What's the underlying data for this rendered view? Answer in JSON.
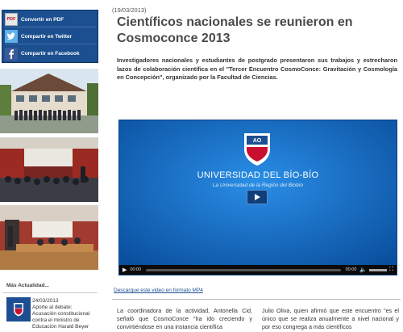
{
  "share": {
    "pdf_icon": "PDF",
    "pdf_label": "Convertir en PDF",
    "twitter_label": "Compartir en Twitter",
    "facebook_label": "Compartir en Facebook"
  },
  "more_news": {
    "title": "Más Actualidad...",
    "date": "24/03/2013",
    "text": "Aporte al debate: Acusación constitucional contra el ministro de Educación Harald Beyer"
  },
  "article": {
    "date": "(19/03/2013)",
    "title": "Científicos nacionales se reunieron en Cosmoconce 2013",
    "lead": "Investigadores nacionales y estudiantes de postgrado presentaron sus trabajos y estrecharon lazos de colaboración científica en el \"Tercer Encuentro CosmoConce: Gravitación y Cosmología en Concepción\", organizado por la Facultad de Ciencias.",
    "video": {
      "university_name": "UNIVERSIDAD DEL BÍO-BÍO",
      "university_tagline": "La Universidad de la Región del Biobío",
      "time_current": "00:00",
      "time_total": "00:00"
    },
    "download_link": "Descargue este video en formato MP4",
    "body_col1": "La coordinadora de la actividad, Antonella Cid, señaló que CosmoConce \"ha ido creciendo y convirtiéndose en una instancia científica",
    "body_col2": "Julio Oliva, quien afirmó que este encuentro \"es el único que se realiza anualmente a nivel nacional y por eso congrega a más científicos"
  }
}
